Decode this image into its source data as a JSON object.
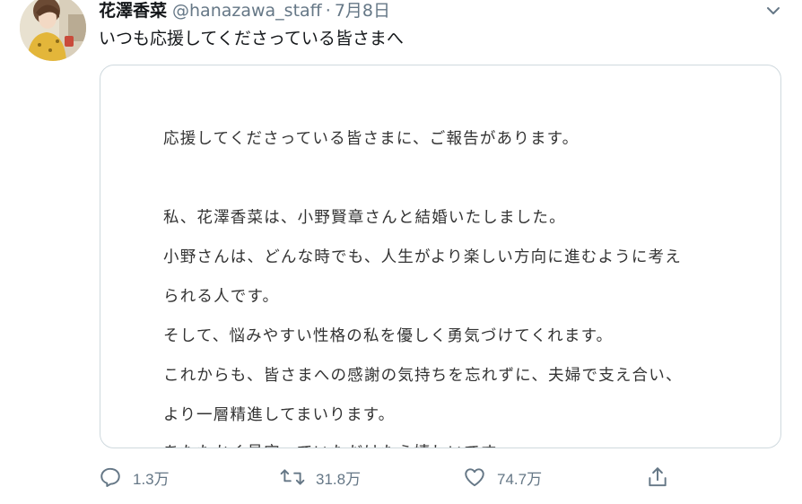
{
  "tweet": {
    "display_name": "花澤香菜",
    "handle": "@hanazawa_staff",
    "separator": "·",
    "date": "7月8日",
    "text": "いつも応援してくださっている皆さまへ",
    "menu_icon": "chevron-down-icon"
  },
  "letter": {
    "lines": [
      "応援してくださっている皆さまに、ご報告があります。",
      "私、花澤香菜は、小野賢章さんと結婚いたしました。",
      "小野さんは、どんな時でも、人生がより楽しい方向に進むように考え",
      "られる人です。",
      "そして、悩みやすい性格の私を優しく勇気づけてくれます。",
      "これからも、皆さまへの感謝の気持ちを忘れずに、夫婦で支え合い、",
      "より一層精進してまいります。",
      "あたたかく見守っていただけたら嬉しいです。"
    ]
  },
  "actions": {
    "reply": {
      "icon": "reply-icon",
      "count": "1.3万"
    },
    "retweet": {
      "icon": "retweet-icon",
      "count": "31.8万"
    },
    "like": {
      "icon": "heart-icon",
      "count": "74.7万"
    },
    "share": {
      "icon": "share-icon"
    }
  },
  "colors": {
    "text": "#14171a",
    "muted": "#657786",
    "border": "#cfd9de"
  }
}
